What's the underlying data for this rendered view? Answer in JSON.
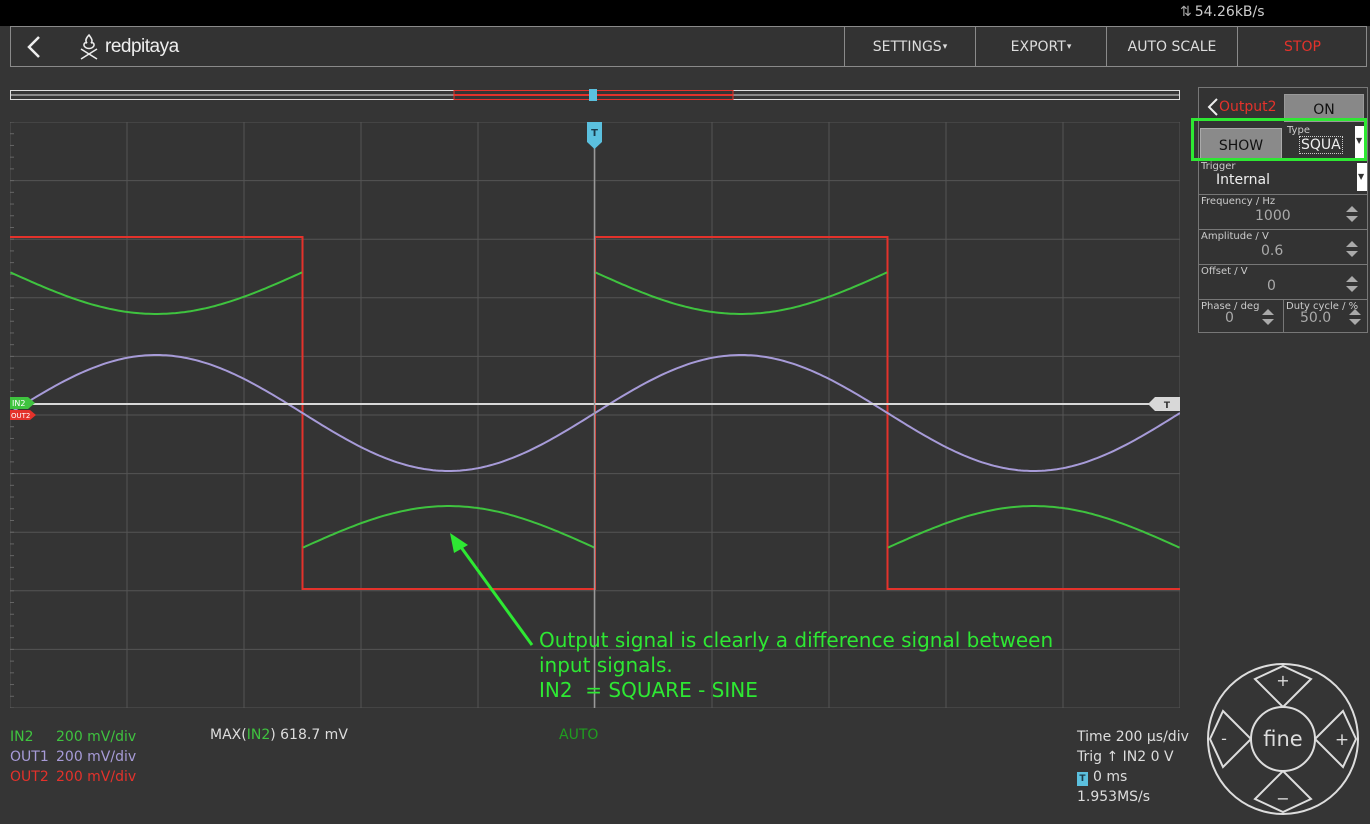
{
  "status_bar": {
    "net_speed": "54.26kB/s"
  },
  "header": {
    "logo_text": "redpitaya",
    "settings_label": "SETTINGS",
    "export_label": "EXPORT",
    "autoscale_label": "AUTO SCALE",
    "stop_label": "STOP"
  },
  "plot": {
    "trigger_marker": "T",
    "level_marker": "T",
    "in2_marker": "IN2",
    "out2_marker": "OUT2"
  },
  "channels": [
    {
      "name": "IN2",
      "scale": "200 mV/div",
      "color": "#3fc33f"
    },
    {
      "name": "OUT1",
      "scale": "200 mV/div",
      "color": "#a79bd8"
    },
    {
      "name": "OUT2",
      "scale": "200 mV/div",
      "color": "#e4322b"
    }
  ],
  "measurement": {
    "label_prefix": "MAX(",
    "channel": "IN2",
    "label_suffix": ") 618.7 mV"
  },
  "trigger_mode": "AUTO",
  "timebase": {
    "time": "Time 200 µs/div",
    "trig_prefix": "Trig",
    "trig_value": "IN2 0 V",
    "offset": "0 ms",
    "sample_rate": "1.953MS/s"
  },
  "output_panel": {
    "title": "Output2",
    "on_label": "ON",
    "show_label": "SHOW",
    "type_label": "Type",
    "type_value": "SQUA",
    "trigger_label": "Trigger",
    "trigger_value": "Internal",
    "frequency_label": "Frequency / Hz",
    "frequency_value": "1000",
    "amplitude_label": "Amplitude / V",
    "amplitude_value": "0.6",
    "offset_label": "Offset / V",
    "offset_value": "0",
    "phase_label": "Phase / deg",
    "phase_value": "0",
    "duty_label": "Duty cycle / %",
    "duty_value": "50.0"
  },
  "joystick": {
    "center_label": "fine",
    "up": "+",
    "down": "−",
    "left": "-",
    "right": "+"
  },
  "annotation": {
    "line1": "Output signal is clearly a difference signal between",
    "line2": "input signals.",
    "line3": "IN2  = SQUARE - SINE"
  },
  "colors": {
    "in2": "#3fc33f",
    "out1": "#a79bd8",
    "out2": "#e4322b",
    "trigger": "#5bc0de",
    "highlight": "#2ee833"
  }
}
